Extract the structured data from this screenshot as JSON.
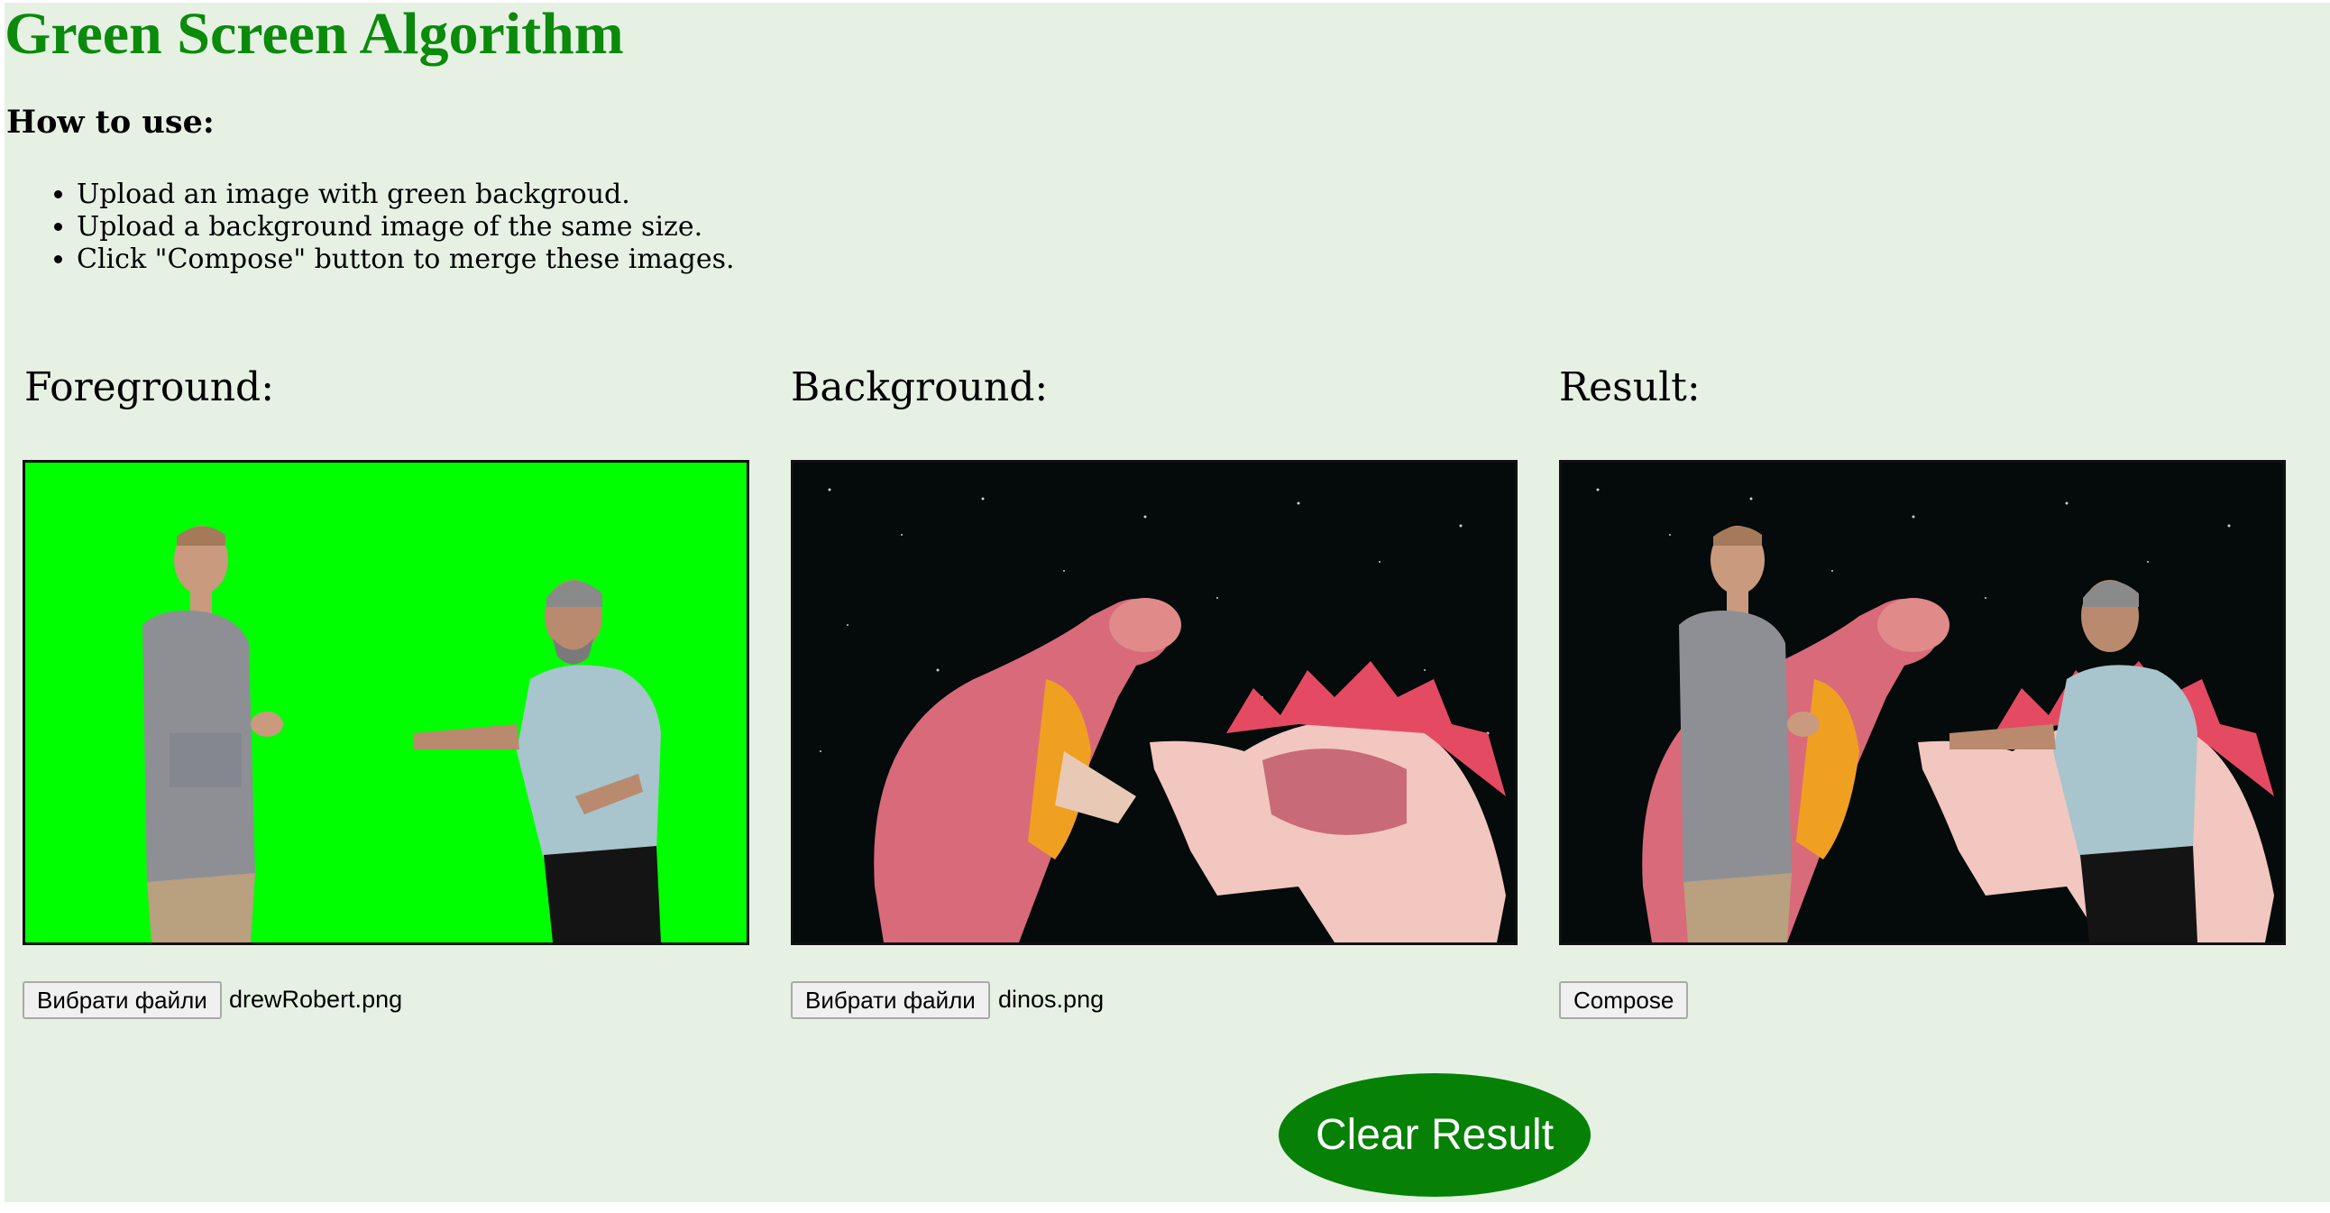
{
  "page": {
    "title": "Green Screen Algorithm",
    "how_to_heading": "How to use:",
    "steps": [
      "Upload an image with green backgroud.",
      "Upload a background image of the same size.",
      "Click \"Compose\" button to merge these images."
    ]
  },
  "columns": {
    "foreground": {
      "label": "Foreground:",
      "button_label": "Вибрати файли",
      "file_name": "drewRobert.png"
    },
    "background": {
      "label": "Background:",
      "button_label": "Вибрати файли",
      "file_name": "dinos.png"
    },
    "result": {
      "label": "Result:",
      "button_label": "Compose"
    }
  },
  "actions": {
    "clear_label": "Clear Result"
  },
  "colors": {
    "page_bg": "#e6f1e4",
    "title": "#0b8a0b",
    "chroma_green": "#00ff00",
    "clear_button": "#068106"
  }
}
